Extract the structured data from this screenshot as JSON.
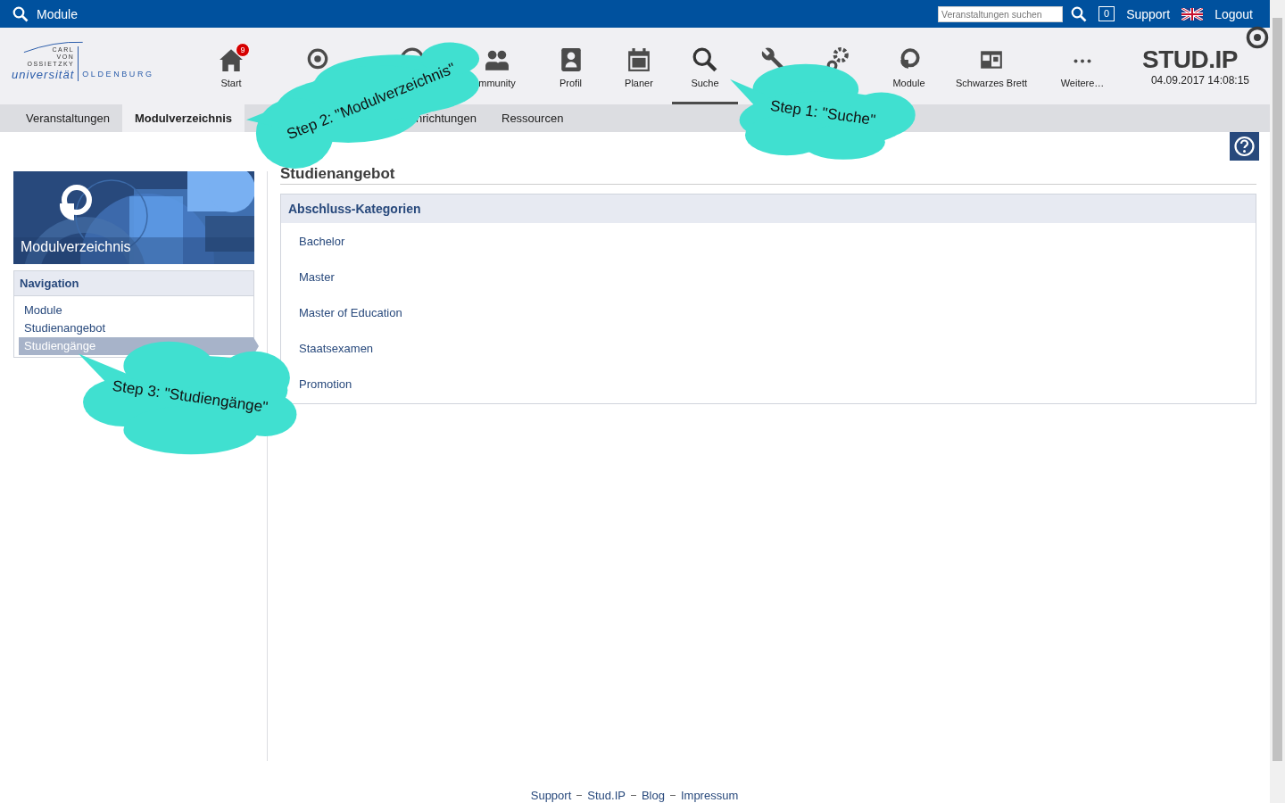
{
  "topbar": {
    "title": "Module",
    "search": {
      "placeholder": "Veranstaltungen suchen"
    },
    "count": "0",
    "links": [
      "Support",
      "Logout"
    ]
  },
  "logo": {
    "lines": [
      "CARL",
      "VON",
      "OSSIETZKY"
    ],
    "name": "universität",
    "city": "OLDENBURG"
  },
  "nav": [
    {
      "kind": "house",
      "label": "Start",
      "badge": "9",
      "selected": false
    },
    {
      "kind": "eye",
      "selected": false
    },
    {
      "kind": "ring",
      "selected": false
    },
    {
      "kind": "people",
      "label": "mmunity",
      "selected": false
    },
    {
      "kind": "person",
      "label": "Profil",
      "selected": false
    },
    {
      "kind": "calendar",
      "label": "Planer",
      "selected": false
    },
    {
      "kind": "search",
      "label": "Suche",
      "selected": true
    },
    {
      "kind": "wrench",
      "selected": false
    },
    {
      "kind": "gear",
      "selected": false
    },
    {
      "kind": "module",
      "label": "Module",
      "selected": false
    },
    {
      "kind": "board",
      "label": "Schwarzes Brett",
      "selected": false
    },
    {
      "kind": "dots",
      "label": "Weitere…",
      "selected": false
    }
  ],
  "brand": {
    "name": "STUD.IP",
    "datetime": "04.09.2017 14:08:15"
  },
  "tabs": [
    {
      "label": "Veranstaltungen",
      "selected": false
    },
    {
      "label": "Modulverzeichnis",
      "selected": true
    },
    {
      "label": "nrichtungen",
      "selected": false
    },
    {
      "label": "Ressourcen",
      "selected": false
    }
  ],
  "sidebar": {
    "image_title": "Modulverzeichnis",
    "nav_title": "Navigation",
    "items": [
      {
        "label": "Module",
        "selected": false
      },
      {
        "label": "Studienangebot",
        "selected": false
      },
      {
        "label": "Studiengänge",
        "selected": true
      }
    ]
  },
  "main": {
    "title": "Studienangebot",
    "panel_title": "Abschluss-Kategorien",
    "items": [
      "Bachelor",
      "Master",
      "Master of Education",
      "Staatsexamen",
      "Promotion"
    ]
  },
  "footer": [
    "Support",
    "Stud.IP",
    "Blog",
    "Impressum"
  ],
  "callouts": [
    {
      "text": "Step 2: \"Modulverzeichnis\""
    },
    {
      "text": "Step 1: \"Suche\""
    },
    {
      "text": "Step 3: \"Studiengänge\""
    }
  ]
}
